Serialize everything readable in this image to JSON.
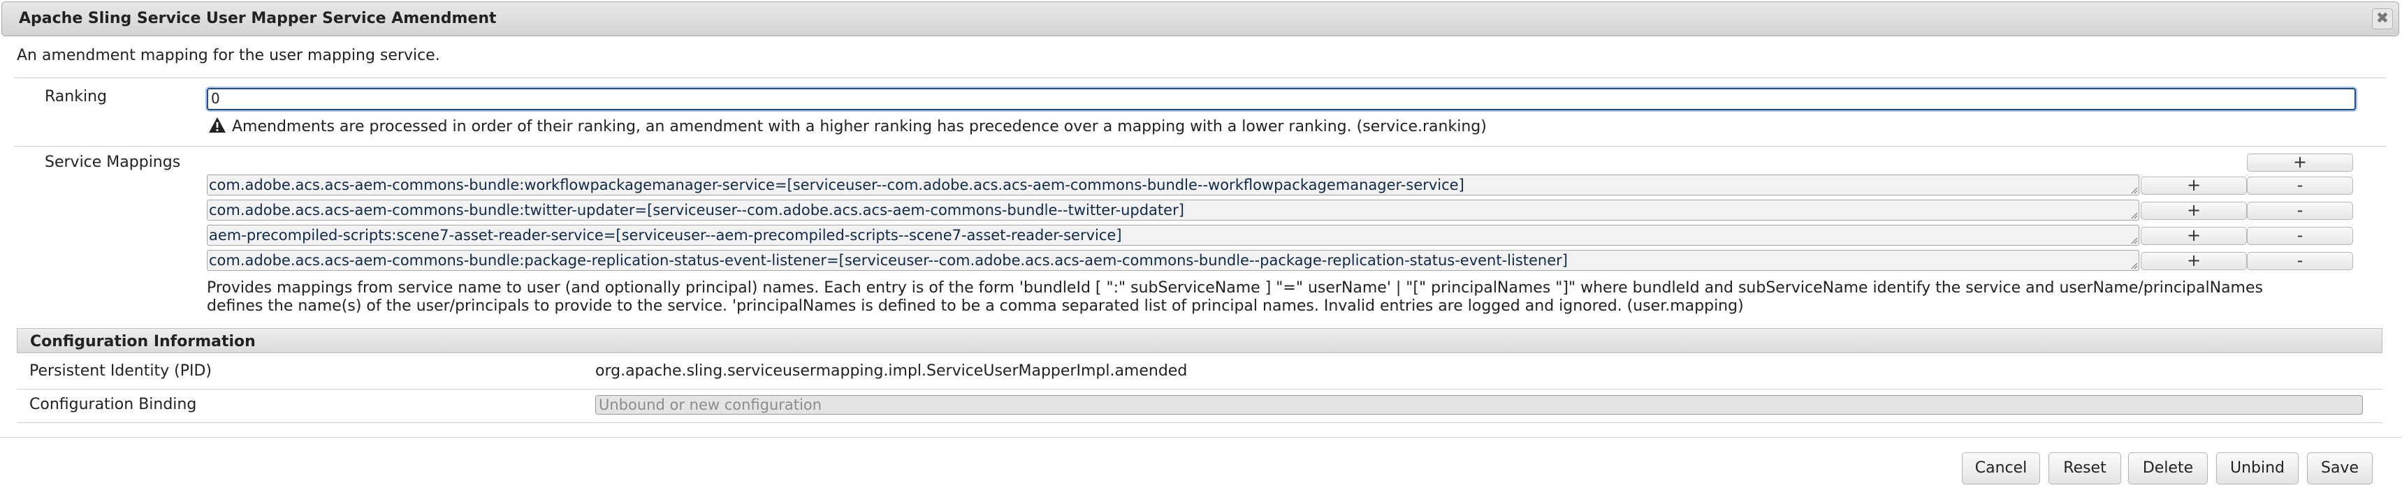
{
  "dialog": {
    "title": "Apache Sling Service User Mapper Service Amendment",
    "close_glyph": "✖",
    "description": "An amendment mapping for the user mapping service."
  },
  "ranking": {
    "label": "Ranking",
    "value": "0",
    "hint": "Amendments are processed in order of their ranking, an amendment with a higher ranking has precedence over a mapping with a lower ranking. (service.ranking)"
  },
  "service_mappings": {
    "label": "Service Mappings",
    "add_label": "+",
    "remove_label": "-",
    "entries": [
      "com.adobe.acs.acs-aem-commons-bundle:workflowpackagemanager-service=[serviceuser--com.adobe.acs.acs-aem-commons-bundle--workflowpackagemanager-service]",
      "com.adobe.acs.acs-aem-commons-bundle:twitter-updater=[serviceuser--com.adobe.acs.acs-aem-commons-bundle--twitter-updater]",
      "aem-precompiled-scripts:scene7-asset-reader-service=[serviceuser--aem-precompiled-scripts--scene7-asset-reader-service]",
      "com.adobe.acs.acs-aem-commons-bundle:package-replication-status-event-listener=[serviceuser--com.adobe.acs.acs-aem-commons-bundle--package-replication-status-event-listener]"
    ],
    "help": "Provides mappings from service name to user (and optionally principal) names. Each entry is of the form 'bundleId [ \":\" subServiceName ] \"=\" userName' | \"[\" principalNames \"]\" where bundleId and subServiceName identify the service and userName/principalNames defines the name(s) of the user/principals to provide to the service. 'principalNames is defined to be a comma separated list of principal names. Invalid entries are logged and ignored. (user.mapping)"
  },
  "config_info": {
    "heading": "Configuration Information",
    "pid_label": "Persistent Identity (PID)",
    "pid_value": "org.apache.sling.serviceusermapping.impl.ServiceUserMapperImpl.amended",
    "binding_label": "Configuration Binding",
    "binding_placeholder": "Unbound or new configuration"
  },
  "actions": {
    "cancel": "Cancel",
    "reset": "Reset",
    "delete": "Delete",
    "unbind": "Unbind",
    "save": "Save"
  }
}
